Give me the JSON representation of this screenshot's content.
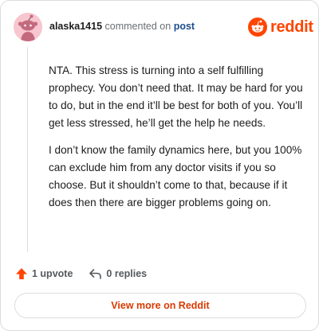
{
  "header": {
    "username": "alaska1415",
    "commented_text": "commented on",
    "post_link": "post",
    "brand": "reddit"
  },
  "comment": {
    "paragraphs": [
      "NTA. This stress is turning into a self fulfilling prophecy. You don’t need that. It may be hard for you to do, but in the end it’ll be best for both of you. You’ll get less stressed, he’ll get the help he needs.",
      "I don’t know the family dynamics here, but you 100% can exclude him from any doctor visits if you so choose. But it shouldn’t come to that, because if it does then there are bigger problems going on."
    ]
  },
  "actions": {
    "upvote_label": "1 upvote",
    "replies_label": "0 replies"
  },
  "footer": {
    "view_more_label": "View more on Reddit"
  },
  "colors": {
    "brand_orange": "#ff4500",
    "link_blue": "#1c4f8c",
    "cta_orange": "#d93a00"
  }
}
